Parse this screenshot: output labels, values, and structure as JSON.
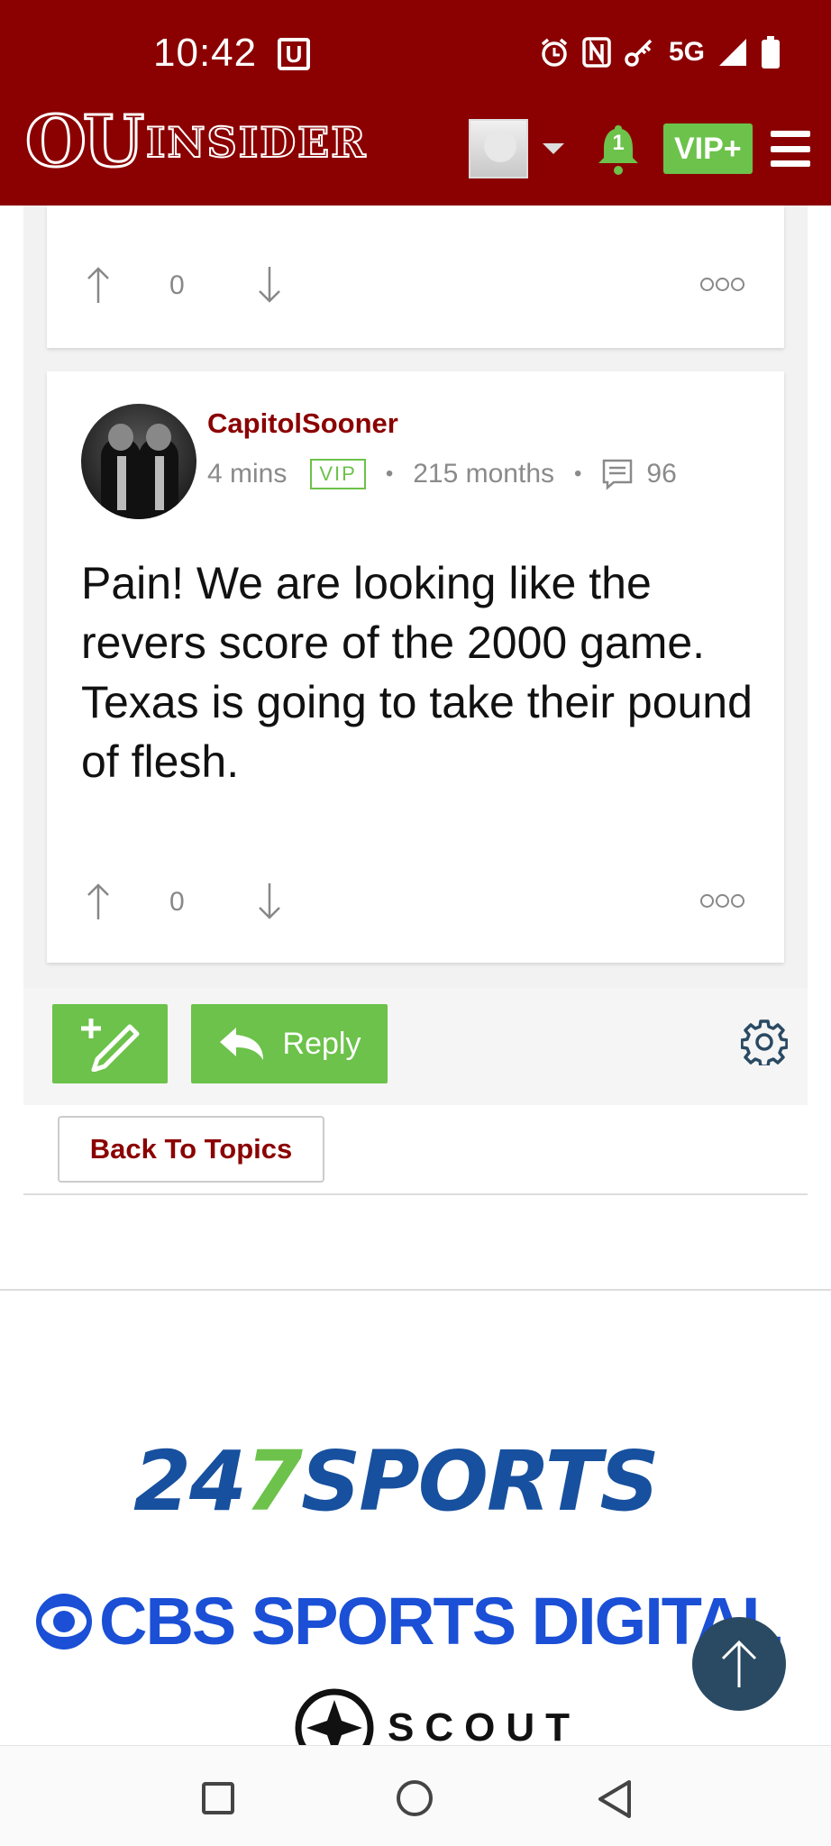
{
  "status_bar": {
    "time": "10:42",
    "u_badge": "U",
    "network": "5G"
  },
  "header": {
    "brand_ou": "OU",
    "brand_insider": "INSIDER",
    "notification_count": "1",
    "vip_label": "VIP+",
    "colors": {
      "background": "#8b0000",
      "accent_green": "#6cc24a"
    }
  },
  "previous_post": {
    "vote_count": "0"
  },
  "post": {
    "username": "CapitolSooner",
    "time_ago": "4 mins",
    "badge": "VIP",
    "member_for": "215 months",
    "comment_count": "96",
    "body": "Pain! We are looking like the revers score of the 2000 game. Texas is going to take their pound of flesh.",
    "vote_count": "0"
  },
  "toolbar": {
    "reply_label": "Reply"
  },
  "back_to_topics_label": "Back To Topics",
  "footer": {
    "logo_247_num": "24",
    "logo_247_seven": "7",
    "logo_247_sports": "SPORTS",
    "cbs_label": "CBS SPORTS DIGITAL",
    "scout_label": "SCOUT"
  }
}
